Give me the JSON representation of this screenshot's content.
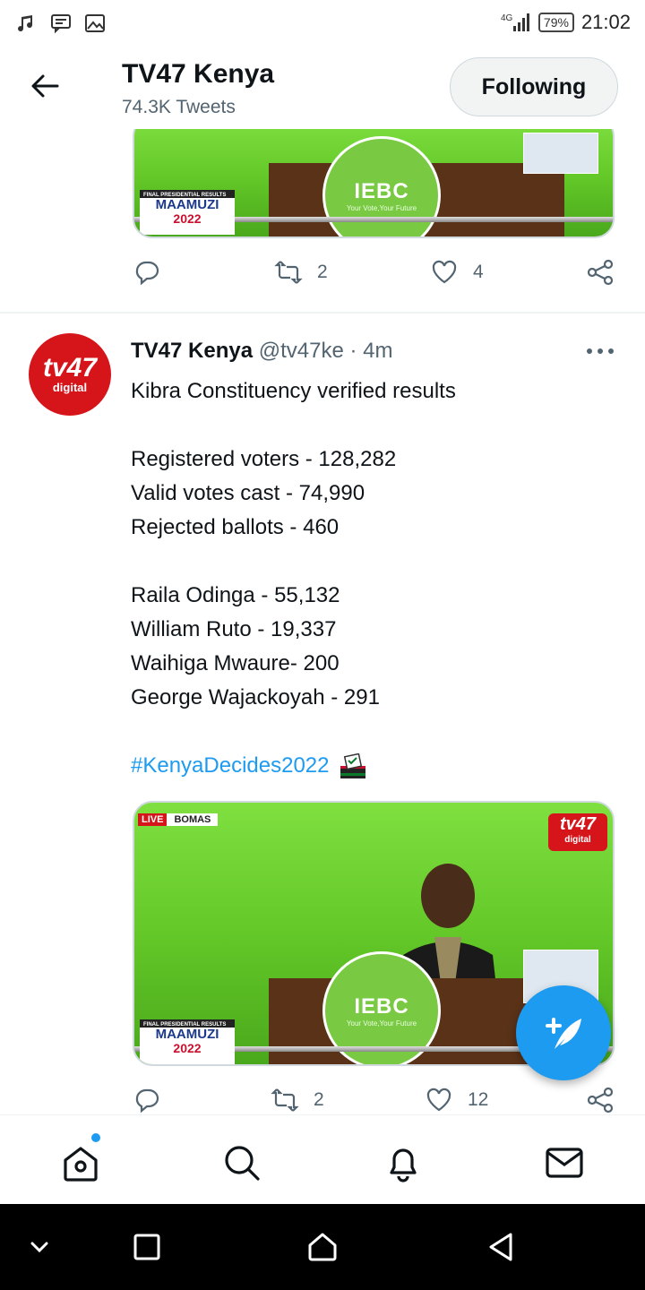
{
  "status_bar": {
    "network": "4G",
    "battery": "79%",
    "time": "21:02"
  },
  "header": {
    "title": "TV47 Kenya",
    "subtitle": "74.3K Tweets",
    "follow_label": "Following"
  },
  "previous_tweet": {
    "media_overlay": {
      "banner": "FINAL PRESIDENTIAL RESULTS",
      "brand": "MAAMUZI",
      "year": "2022",
      "iebc": "IEBC",
      "iebc_tagline": "Your Vote,Your Future"
    },
    "actions": {
      "retweets": "2",
      "likes": "4"
    }
  },
  "tweet": {
    "avatar_text": "tv47",
    "avatar_sub": "digital",
    "name": "TV47 Kenya",
    "handle": "@tv47ke",
    "separator": "·",
    "time": "4m",
    "lines": [
      "Kibra Constituency verified results",
      "",
      "Registered voters - 128,282",
      "Valid votes cast - 74,990",
      "Rejected ballots - 460",
      "",
      "Raila Odinga - 55,132",
      "William Ruto - 19,337",
      "Waihiga Mwaure- 200",
      "George Wajackoyah - 291",
      ""
    ],
    "hashtag": "#KenyaDecides2022",
    "media_overlay": {
      "live": "LIVE",
      "location": "BOMAS",
      "logo": "tv47",
      "logo_sub": "digital",
      "banner": "FINAL PRESIDENTIAL RESULTS",
      "brand": "MAAMUZI",
      "year": "2022",
      "iebc": "IEBC",
      "iebc_tagline": "Your Vote,Your Future"
    },
    "actions": {
      "retweets": "2",
      "likes": "12"
    }
  },
  "colors": {
    "accent": "#1d9bf0",
    "brand_red": "#d6151b",
    "secondary_text": "#536471"
  },
  "icons": {
    "status_left": [
      "music-icon",
      "message-icon",
      "image-icon"
    ],
    "bottom_nav": [
      "home-icon",
      "search-icon",
      "notifications-icon",
      "messages-icon"
    ],
    "system_nav": [
      "collapse-icon",
      "recents-icon",
      "home-button-icon",
      "back-button-icon"
    ]
  }
}
